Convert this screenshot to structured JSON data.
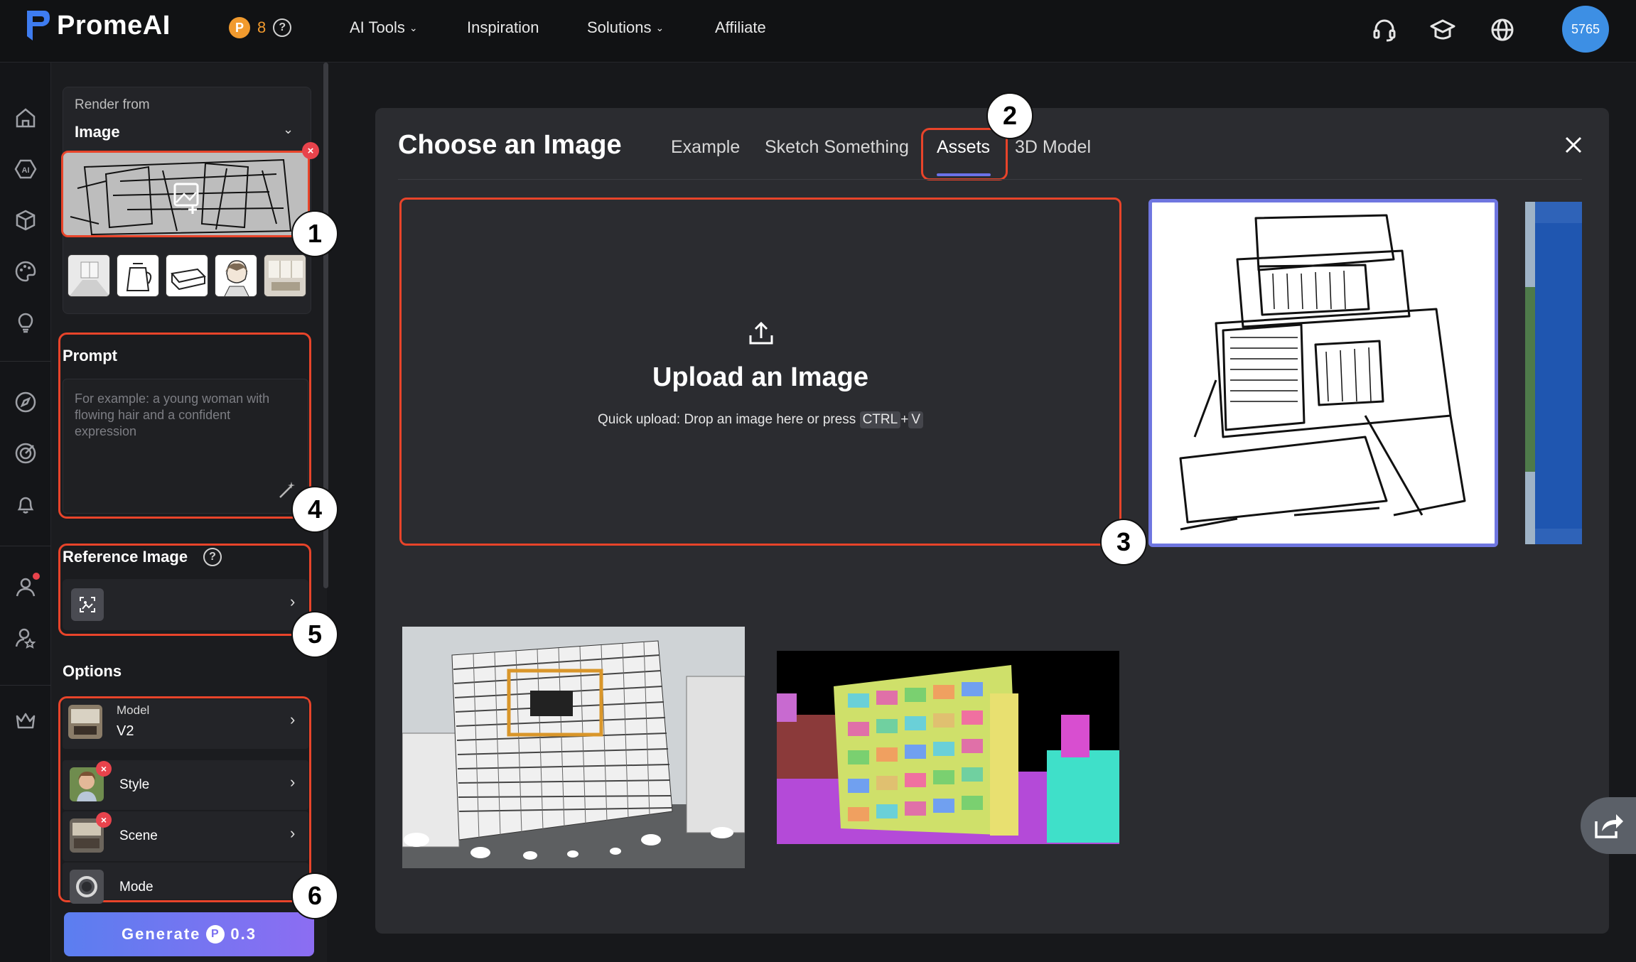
{
  "app": {
    "logo_text": "PromeAI",
    "credits": "8",
    "help_glyph": "?",
    "avatar_label": "5765"
  },
  "nav": {
    "ai_tools": "AI Tools",
    "inspiration": "Inspiration",
    "solutions": "Solutions",
    "affiliate": "Affiliate"
  },
  "top_icons": [
    "headset-icon",
    "graduation-cap-icon",
    "globe-icon"
  ],
  "rail_icons": [
    "home-icon",
    "ai-icon",
    "cube-icon",
    "palette-icon",
    "lightbulb-icon",
    "compass-icon",
    "target-icon",
    "bell-icon",
    "user-icon",
    "user-star-icon",
    "crown-icon"
  ],
  "panel": {
    "render_from_label": "Render from",
    "render_from_value": "Image",
    "prompt_title": "Prompt",
    "prompt_placeholder": "For example: a young woman with flowing hair and a confident expression",
    "reference_title": "Reference Image",
    "options_title": "Options",
    "model_label": "Model",
    "model_value": "V2",
    "style_label": "Style",
    "scene_label": "Scene",
    "mode_label": "Mode",
    "generate_label": "Generate",
    "generate_cost": "0.3"
  },
  "modal": {
    "title": "Choose an Image",
    "tabs": [
      "Example",
      "Sketch Something",
      "Assets",
      "3D Model"
    ],
    "active_tab": "Assets",
    "upload_title": "Upload an Image",
    "upload_sub_prefix": "Quick upload: Drop an image here or press",
    "kbd_ctrl": "CTRL",
    "kbd_plus": "+",
    "kbd_v": "V"
  },
  "annotations": [
    "1",
    "2",
    "3",
    "4",
    "5",
    "6"
  ],
  "colors": {
    "accent_red": "#e8442a",
    "accent_purple": "#6b72e8",
    "coin_orange": "#f19a2e",
    "avatar_blue": "#3d8fe4"
  }
}
